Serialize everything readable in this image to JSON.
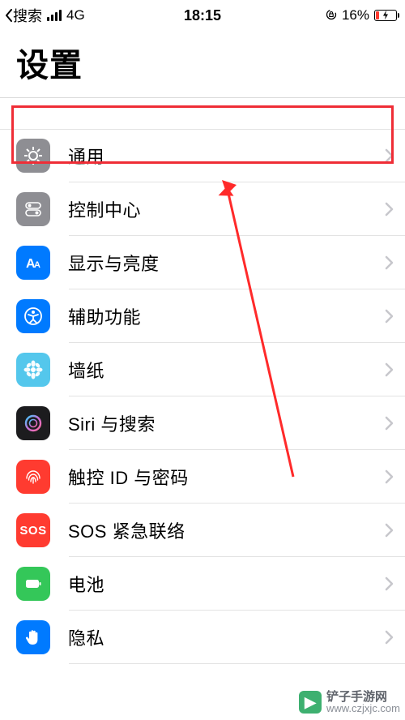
{
  "status_bar": {
    "back_label": "搜索",
    "network": "4G",
    "time": "18:15",
    "battery_pct": "16%"
  },
  "header": {
    "title": "设置"
  },
  "rows": [
    {
      "id": "general",
      "label": "通用",
      "icon_name": "gear-icon"
    },
    {
      "id": "control-center",
      "label": "控制中心",
      "icon_name": "switches-icon"
    },
    {
      "id": "display",
      "label": "显示与亮度",
      "icon_name": "text-size-icon"
    },
    {
      "id": "accessibility",
      "label": "辅助功能",
      "icon_name": "accessibility-icon"
    },
    {
      "id": "wallpaper",
      "label": "墙纸",
      "icon_name": "flower-icon"
    },
    {
      "id": "siri",
      "label": "Siri 与搜索",
      "icon_name": "siri-icon"
    },
    {
      "id": "touchid",
      "label": "触控 ID 与密码",
      "icon_name": "fingerprint-icon"
    },
    {
      "id": "sos",
      "label": "SOS 紧急联络",
      "icon_name": "sos-icon",
      "icon_text": "SOS"
    },
    {
      "id": "battery",
      "label": "电池",
      "icon_name": "battery-icon"
    },
    {
      "id": "privacy",
      "label": "隐私",
      "icon_name": "hand-icon"
    }
  ],
  "watermark": {
    "name": "铲子手游网",
    "url": "www.czjxjc.com"
  }
}
